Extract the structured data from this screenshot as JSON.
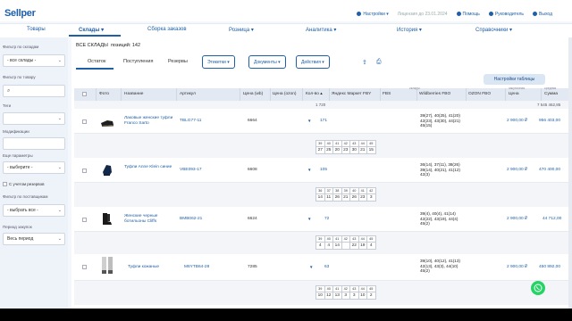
{
  "app": {
    "logo": "Sellper",
    "top_right": {
      "settings": "Настройки",
      "license": "Лицензия до 23.01.2024",
      "help": "Помощь",
      "user": "Руководитель",
      "logout": "Выход"
    }
  },
  "nav": [
    {
      "label": "Товары"
    },
    {
      "label": "Склады ▾"
    },
    {
      "label": "Сборка заказов"
    },
    {
      "label": "Розница ▾"
    },
    {
      "label": "Аналитика ▾"
    },
    {
      "label": "История ▾"
    },
    {
      "label": "Справочники ▾"
    }
  ],
  "sidebar": {
    "warehouse_filter_label": "Фильтр по складам",
    "warehouse_filter_value": "- все склады -",
    "product_filter_label": "Фильтр по товару",
    "search_placeholder": "",
    "tags_label": "Теги",
    "tags_value": "",
    "modifications_label": "Модификации",
    "modifications_value": "",
    "more_params_label": "Еще параметры",
    "more_params_value": "- выберите -",
    "reserves_label": "С учетом резервов",
    "supplier_filter_label": "Фильтр по поставщикам",
    "supplier_filter_value": "- выбрать все -",
    "period_label": "Период закупок",
    "period_value": "Весь период"
  },
  "main": {
    "warehouse_title": "ВСЕ СКЛАДЫ",
    "positions_label": "позиций: 142",
    "tabs": [
      "Остаток",
      "Поступления",
      "Резервы"
    ],
    "buttons": {
      "tags": "Этикетки ▾",
      "documents": "Документы ▾",
      "actions": "Действия ▾",
      "table_settings": "Настройки таблицы"
    },
    "columns": {
      "photo": "Фото",
      "name": "Название",
      "article": "Артикул",
      "price_wb": "Цена (wb)",
      "price_ozon": "Цена (ozon)",
      "qty": "Кол-во ▴",
      "ym_fby": "Яндекс Маркет FBY",
      "fbs": "FBS",
      "wb_fbo": "Wildberries FBO",
      "ozon_fbo": "OZON FBO",
      "price": "Цена",
      "sum": "Сумма",
      "group_stock": "склады",
      "group_purchase": "закупочная",
      "group_average": "средняя"
    },
    "totals": {
      "qty": "1 720",
      "sum": "7 545 462,85"
    },
    "rows": [
      {
        "name": "Лаковые женские туфли Franco Sarto",
        "article": "TBLG77-11",
        "price_wb": "6664",
        "qty": "171",
        "wb_lines": [
          "39(27), 40(25), 41(20)",
          "42(23), 43(30), 44(21)",
          "45(15)"
        ],
        "price": "2 900,00 ₽",
        "sum": "956 403,00",
        "sizes": [
          "39",
          "40",
          "41",
          "42",
          "43",
          "44",
          "45"
        ],
        "counts": [
          "27",
          "25",
          "20",
          "23",
          "30",
          "21",
          "15"
        ]
      },
      {
        "name": "Туфли Anne Klein синие",
        "article": "VBE093-17",
        "price_wb": "6608",
        "qty": "105",
        "wb_lines": [
          "36(14), 37(11), 38(26)",
          "39(14), 40(21), 41(12)",
          "42(3)"
        ],
        "price": "2 900,00 ₽",
        "sum": "470 400,00",
        "sizes": [
          "36",
          "37",
          "38",
          "39",
          "40",
          "41",
          "42"
        ],
        "counts": [
          "14",
          "11",
          "26",
          "21",
          "26",
          "23",
          "3"
        ]
      },
      {
        "name": "Женские черные ботильоны Cliffs",
        "article": "BMB062-21",
        "price_wb": "6624",
        "qty": "72",
        "wb_lines": [
          "39(4), 40(4), 41(14)",
          "42(22), 43(19), 44(4)",
          "45(2)"
        ],
        "price": "2 900,00 ₽",
        "sum": "44 712,00",
        "sizes": [
          "39",
          "40",
          "41",
          "42",
          "43",
          "44",
          "45"
        ],
        "counts": [
          "4",
          "4",
          "14",
          "",
          "22",
          "19",
          "4"
        ]
      },
      {
        "name": "Туфли кожаные",
        "article": "M6YTB64-28",
        "price_wb": "7285",
        "qty": "63",
        "wb_lines": [
          "39(10), 40(12), 41(13)",
          "42(13), 43(3), 44(10)",
          "45(2)"
        ],
        "price": "2 900,00 ₽",
        "sum": "450 892,00",
        "sizes": [
          "39",
          "40",
          "41",
          "42",
          "43",
          "44",
          "45"
        ],
        "counts": [
          "10",
          "12",
          "13",
          "3",
          "3",
          "10",
          "2"
        ]
      }
    ]
  },
  "colors": {
    "brand": "#1e5fa8",
    "header_bg": "#e3e9f2",
    "sidebar_bg": "#eef3fa",
    "whatsapp": "#25d366"
  },
  "icons": [
    "settings-icon",
    "help-icon",
    "user-icon",
    "logout-icon",
    "search-icon",
    "upload-icon",
    "print-icon",
    "whatsapp-icon",
    "chevron-down-icon"
  ]
}
